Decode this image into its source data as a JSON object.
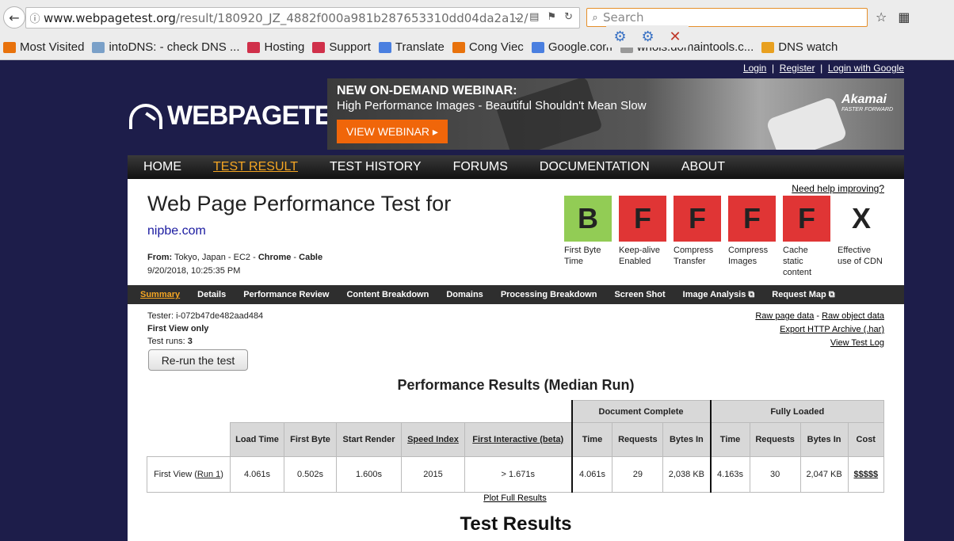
{
  "browser": {
    "url_host": "www.webpagetest.org",
    "url_path": "/result/180920_JZ_4882f000a981b287653310dd04da2a12/",
    "search_placeholder": "Search",
    "bookmarks": [
      {
        "label": "Most Visited",
        "color": "#e8720c"
      },
      {
        "label": "intoDNS: - check DNS ...",
        "color": "#7aa0c8"
      },
      {
        "label": "Hosting",
        "color": "#d0304a"
      },
      {
        "label": "Support",
        "color": "#d0304a"
      },
      {
        "label": "Translate",
        "color": "#4a7fe0"
      },
      {
        "label": "Cong Viec",
        "color": "#e8720c"
      },
      {
        "label": "Google.com",
        "color": "#4a7fe0"
      },
      {
        "label": "whois.domaintools.c...",
        "color": "#999999"
      },
      {
        "label": "DNS watch",
        "color": "#e8a020"
      }
    ]
  },
  "header": {
    "links": [
      "Login",
      "Register",
      "Login with Google"
    ],
    "logo_text": "WEBPAGETEST"
  },
  "banner": {
    "headline": "NEW ON-DEMAND WEBINAR:",
    "subline": "High Performance Images - Beautiful Shouldn't Mean Slow",
    "button": "VIEW WEBINAR",
    "brand": "Akamai",
    "brand_tag": "FASTER FORWARD"
  },
  "nav": [
    "HOME",
    "TEST RESULT",
    "TEST HISTORY",
    "FORUMS",
    "DOCUMENTATION",
    "ABOUT"
  ],
  "summary": {
    "help_link": "Need help improving?",
    "title": "Web Page Performance Test for",
    "site": "nipbe.com",
    "from_label": "From:",
    "from_location": "Tokyo, Japan - EC2 -",
    "browser": "Chrome",
    "connection": "Cable",
    "date": "9/20/2018, 10:25:35 PM"
  },
  "grades": [
    {
      "grade": "B",
      "label": "First Byte Time",
      "color": "#92cc55"
    },
    {
      "grade": "F",
      "label": "Keep-alive Enabled",
      "color": "#e03535"
    },
    {
      "grade": "F",
      "label": "Compress Transfer",
      "color": "#e03535"
    },
    {
      "grade": "F",
      "label": "Compress Images",
      "color": "#e03535"
    },
    {
      "grade": "F",
      "label": "Cache static content",
      "color": "#e03535"
    },
    {
      "grade": "X",
      "label": "Effective use of CDN",
      "color": "#ffffff"
    }
  ],
  "subnav": [
    "Summary",
    "Details",
    "Performance Review",
    "Content Breakdown",
    "Domains",
    "Processing Breakdown",
    "Screen Shot",
    "Image Analysis",
    "Request Map"
  ],
  "test_info": {
    "tester": "Tester: i-072b47de482aad484",
    "view": "First View only",
    "runs_label": "Test runs:",
    "runs": "3",
    "rerun_button": "Re-run the test"
  },
  "right_links": [
    "Raw page data",
    "Raw object data",
    "Export HTTP Archive (.har)",
    "View Test Log"
  ],
  "results": {
    "title": "Performance Results (Median Run)",
    "group_doc": "Document Complete",
    "group_full": "Fully Loaded",
    "headers": [
      "Load Time",
      "First Byte",
      "Start Render",
      "Speed Index",
      "First Interactive (beta)",
      "Time",
      "Requests",
      "Bytes In",
      "Time",
      "Requests",
      "Bytes In",
      "Cost"
    ],
    "row_label": "First View (",
    "row_run": "Run 1",
    "row_close": ")",
    "row": [
      "4.061s",
      "0.502s",
      "1.600s",
      "2015",
      "> 1.671s",
      "4.061s",
      "29",
      "2,038 KB",
      "4.163s",
      "30",
      "2,047 KB",
      "$$$$$"
    ],
    "plot_link": "Plot Full Results",
    "test_results_title": "Test Results"
  }
}
